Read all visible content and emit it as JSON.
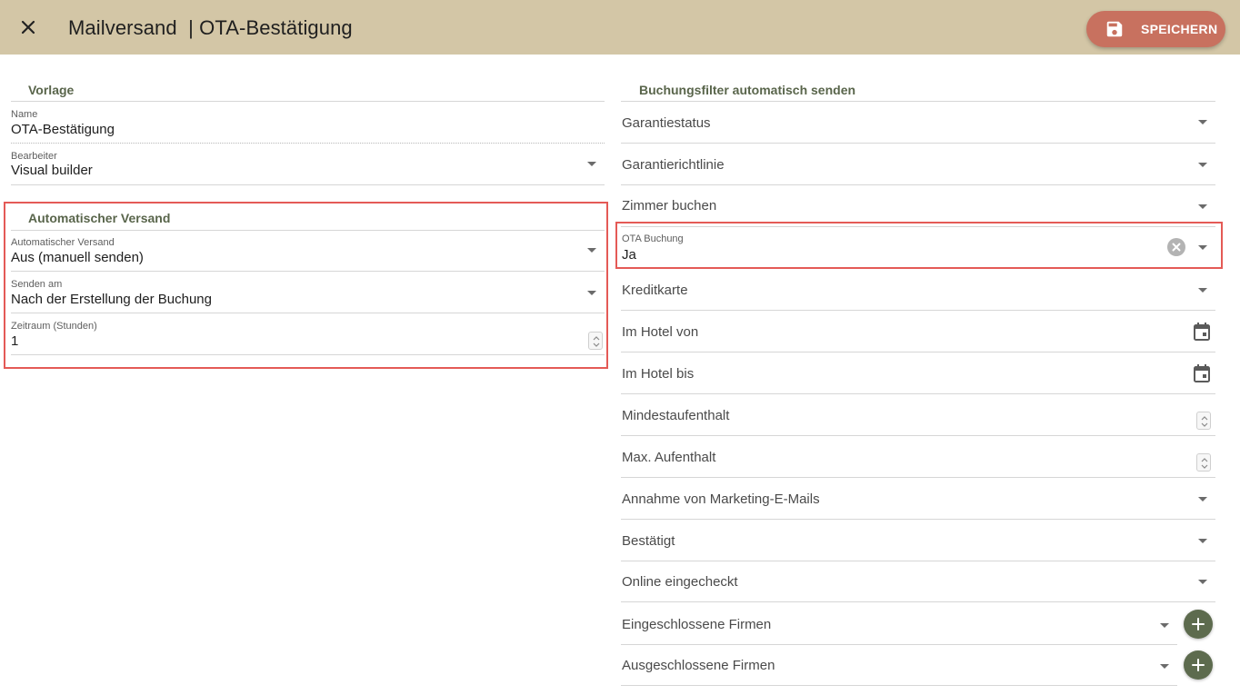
{
  "header": {
    "title": "Mailversand  | OTA-Bestätigung",
    "save_label": "SPEICHERN",
    "color": "#d3c6a6",
    "save_color": "#c8715f"
  },
  "vorlage": {
    "heading": "Vorlage",
    "name_label": "Name",
    "name_value": "OTA-Bestätigung",
    "editor_label": "Bearbeiter",
    "editor_value": "Visual builder"
  },
  "auto": {
    "heading": "Automatischer Versand",
    "mode_label": "Automatischer Versand",
    "mode_value": "Aus (manuell senden)",
    "send_on_label": "Senden am",
    "send_on_value": "Nach der Erstellung der Buchung",
    "period_label": "Zeitraum (Stunden)",
    "period_value": "1"
  },
  "filters": {
    "heading": "Buchungsfilter automatisch senden",
    "garantiestatus": "Garantiestatus",
    "garantierichtlinie": "Garantierichtlinie",
    "zimmer": "Zimmer buchen",
    "ota_label": "OTA Buchung",
    "ota_value": "Ja",
    "kreditkarte": "Kreditkarte",
    "hotel_von": "Im Hotel von",
    "hotel_bis": "Im Hotel bis",
    "min_stay": "Mindestaufenthalt",
    "max_stay": "Max. Aufenthalt",
    "marketing": "Annahme von Marketing-E-Mails",
    "bestaetigt": "Bestätigt",
    "online": "Online eingecheckt",
    "incl_firms": "Eingeschlossene Firmen",
    "excl_firms": "Ausgeschlossene Firmen"
  },
  "icons": {
    "close": "close-icon",
    "save": "floppy-disk-icon",
    "dropdown": "chevron-down-icon",
    "calendar": "calendar-icon",
    "clear": "clear-icon",
    "add": "plus-icon"
  },
  "colors": {
    "accent_green": "#59654b",
    "highlight_red": "#e45a56"
  }
}
